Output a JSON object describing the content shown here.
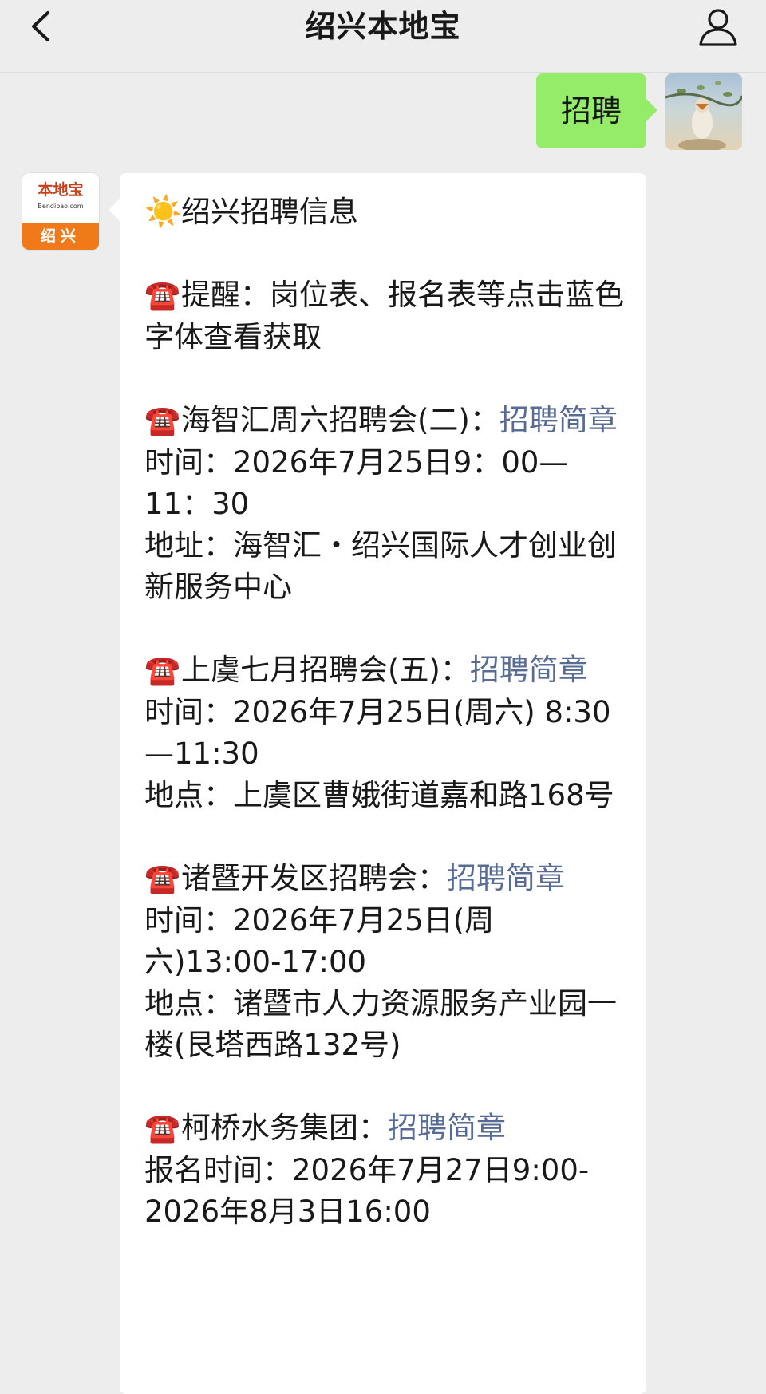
{
  "header": {
    "title": "绍兴本地宝"
  },
  "sent_message": {
    "text": "招聘"
  },
  "bot_avatar": {
    "brand": "本地宝",
    "domain": "Bendibao.com",
    "city": "绍兴"
  },
  "reply": {
    "heading": "绍兴招聘信息",
    "reminder": "提醒：岗位表、报名表等点击蓝色字体查看获取",
    "fairs": [
      {
        "title": "海智汇周六招聘会(二)：",
        "link": "招聘简章",
        "line1": "时间：2026年7月25日9：00—11：30",
        "line2": "地址：海智汇・绍兴国际人才创业创新服务中心"
      },
      {
        "title": "上虞七月招聘会(五)：",
        "link": "招聘简章",
        "line1": "时间：2026年7月25日(周六) 8:30—11:30",
        "line2": "地点：上虞区曹娥街道嘉和路168号"
      },
      {
        "title": "诸暨开发区招聘会：",
        "link": "招聘简章",
        "line1": "时间：2026年7月25日(周六)13:00-17:00",
        "line2": "地点：诸暨市人力资源服务产业园一楼(艮塔西路132号)"
      },
      {
        "title": "柯桥水务集团：",
        "link": "招聘简章",
        "line1": "报名时间：2026年7月27日9:00-2026年8月3日16:00"
      }
    ]
  },
  "icons": {
    "back": "chevron-left-icon",
    "profile": "person-icon",
    "sun": "sun-icon",
    "phone": "telephone-icon"
  },
  "colors": {
    "background": "#ededed",
    "sent_bubble": "#95ec69",
    "link": "#576b95",
    "phone_icon": "#d22630"
  }
}
